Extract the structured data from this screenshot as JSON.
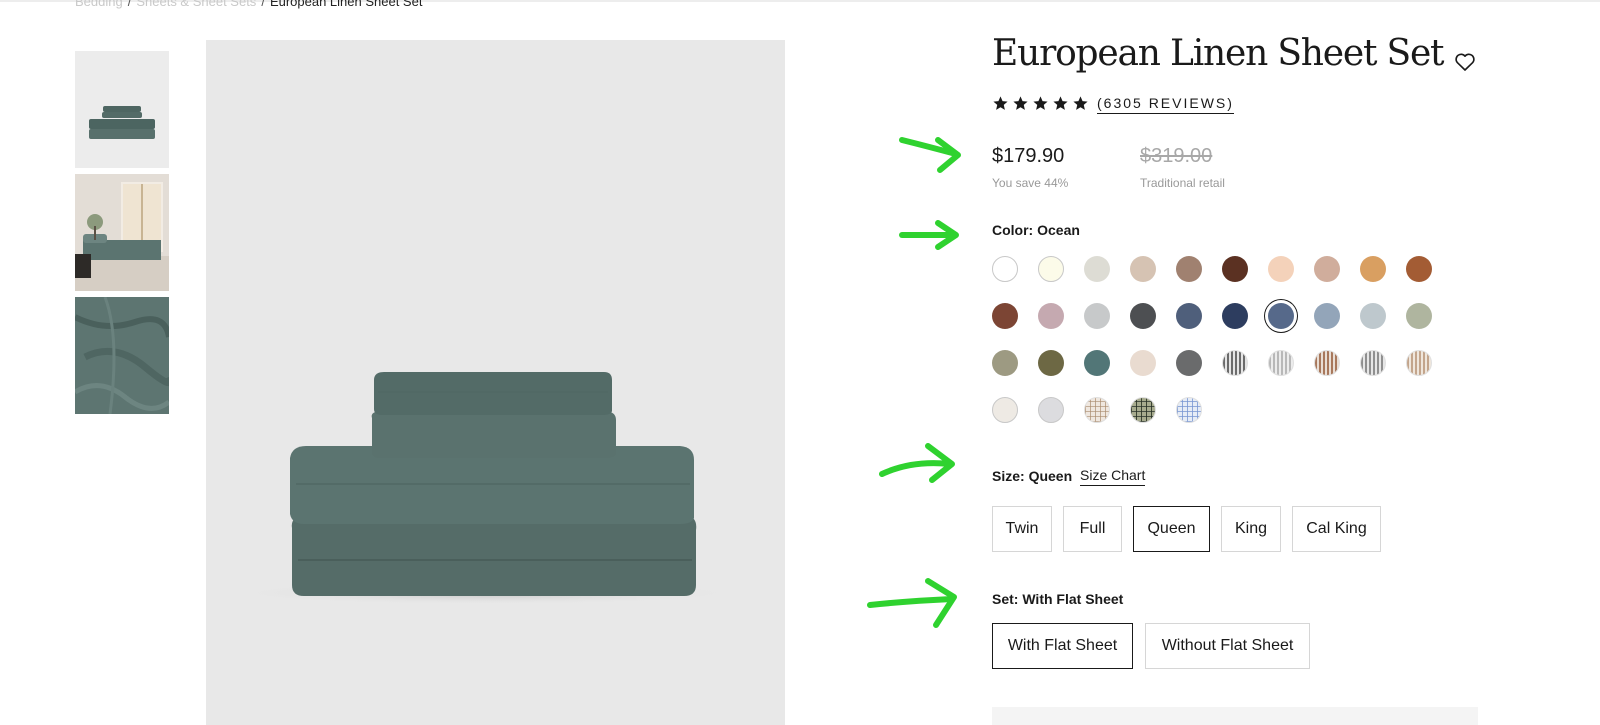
{
  "breadcrumb": {
    "items": [
      "Bedding",
      "Sheets & Sheet Sets"
    ],
    "separator": "/",
    "current": "European Linen Sheet Set"
  },
  "product": {
    "title": "European Linen Sheet Set",
    "rating_stars": 5,
    "reviews_label": "(6305 REVIEWS)",
    "price": "$179.90",
    "savings": "You save 44%",
    "retail_price": "$319.00",
    "retail_label": "Traditional retail",
    "product_color": "#566d69"
  },
  "color": {
    "label": "Color: Ocean",
    "selected": "Ocean",
    "swatches": [
      [
        "#ffffff",
        "#fcfbe9",
        "#dddcd4",
        "#d6c3b3",
        "#a08170",
        "#5b3122",
        "#f4d2ba",
        "#d0ad9c",
        "#d99f61",
        "#a35c34"
      ],
      [
        "#7c4534",
        "#c5a9b0",
        "#c7c9ca",
        "#4d4f52",
        "#4f5f7b",
        "#2d3d5f",
        "#56698a",
        "#93a5b9",
        "#bec8cd",
        "#afb59f"
      ],
      [
        "#9d9a82",
        "#6d6844",
        "#527677",
        "#e9dbd0",
        "#6a6b6c",
        "stripe-dark",
        "stripe-light",
        "stripe-brown",
        "stripe-grey",
        "stripe-tan"
      ],
      [
        "#eeeae4",
        "#dcdcdf",
        "check-tan",
        "check-dark",
        "check-blue"
      ]
    ]
  },
  "size": {
    "label": "Size: Queen",
    "chart_link": "Size Chart",
    "options": [
      "Twin",
      "Full",
      "Queen",
      "King",
      "Cal King"
    ],
    "selected": "Queen"
  },
  "set": {
    "label": "Set: With Flat Sheet",
    "options": [
      "With Flat Sheet",
      "Without Flat Sheet"
    ],
    "selected": "With Flat Sheet"
  },
  "icons": {
    "wishlist": "heart-outline-icon",
    "star": "star-filled-icon",
    "annotation": "green-arrow"
  },
  "colors": {
    "annotation_arrow": "#2fd22f",
    "text": "#1a1a1a",
    "muted": "#999999",
    "image_bg": "#e8e8e8"
  }
}
